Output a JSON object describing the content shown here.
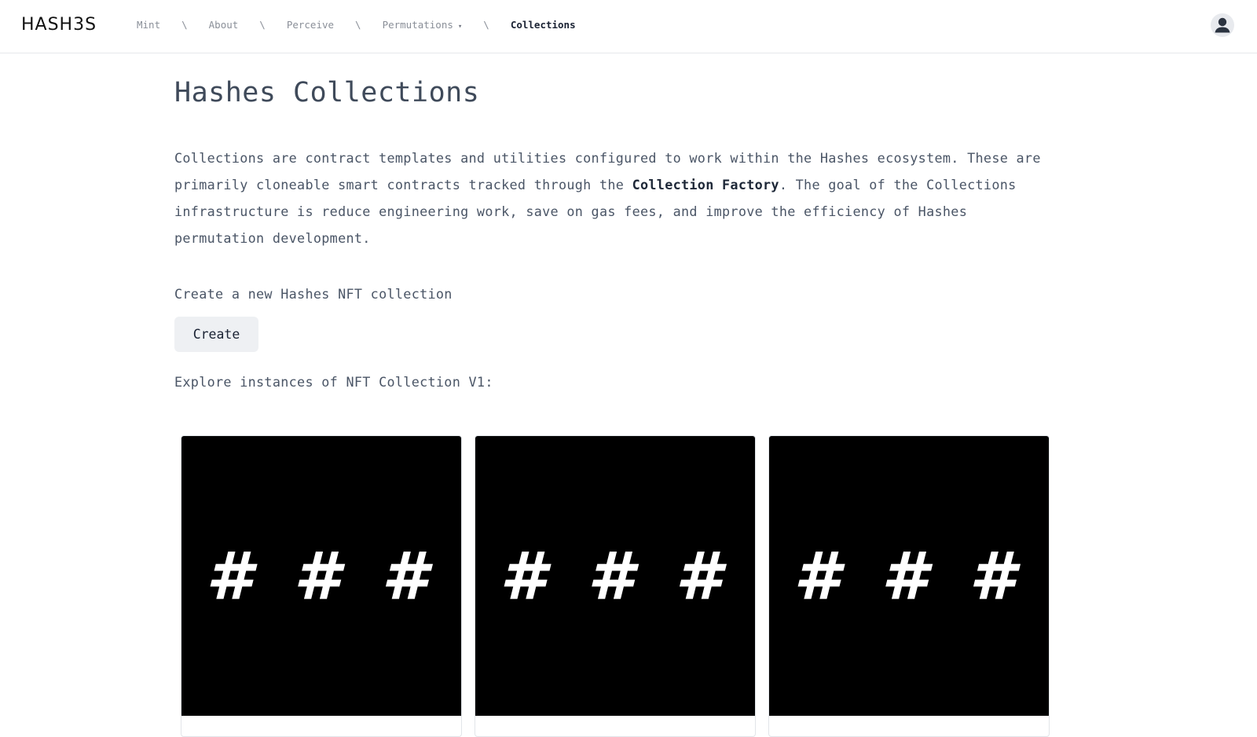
{
  "header": {
    "logo": "HASH3S",
    "nav": [
      {
        "label": "Mint",
        "active": false
      },
      {
        "label": "About",
        "active": false
      },
      {
        "label": "Perceive",
        "active": false
      },
      {
        "label": "Permutations",
        "active": false,
        "dropdown": true
      },
      {
        "label": "Collections",
        "active": true
      }
    ],
    "separator": "\\",
    "dropdown_caret": "▾"
  },
  "main": {
    "title": "Hashes Collections",
    "intro": {
      "before": "Collections are contract templates and utilities configured to work within the Hashes ecosystem. These are primarily cloneable smart contracts tracked through the ",
      "link": "Collection Factory",
      "after": ". The goal of the Collections infrastructure is reduce engineering work, save on gas fees, and improve the efficiency of Hashes permutation development."
    },
    "create_label": "Create a new Hashes NFT collection",
    "create_button": "Create",
    "explore_label": "Explore instances of NFT Collection V1:",
    "cards": [
      {
        "thumb_text": "# # #"
      },
      {
        "thumb_text": "# # #"
      },
      {
        "thumb_text": "# # #"
      }
    ]
  },
  "colors": {
    "accent_text": "#1a2233",
    "muted_text": "#8a8f98",
    "body_text": "#4a5566",
    "button_bg": "#eef0f3",
    "card_thumb_bg": "#000000"
  },
  "icons": {
    "avatar": "user-avatar-icon"
  }
}
